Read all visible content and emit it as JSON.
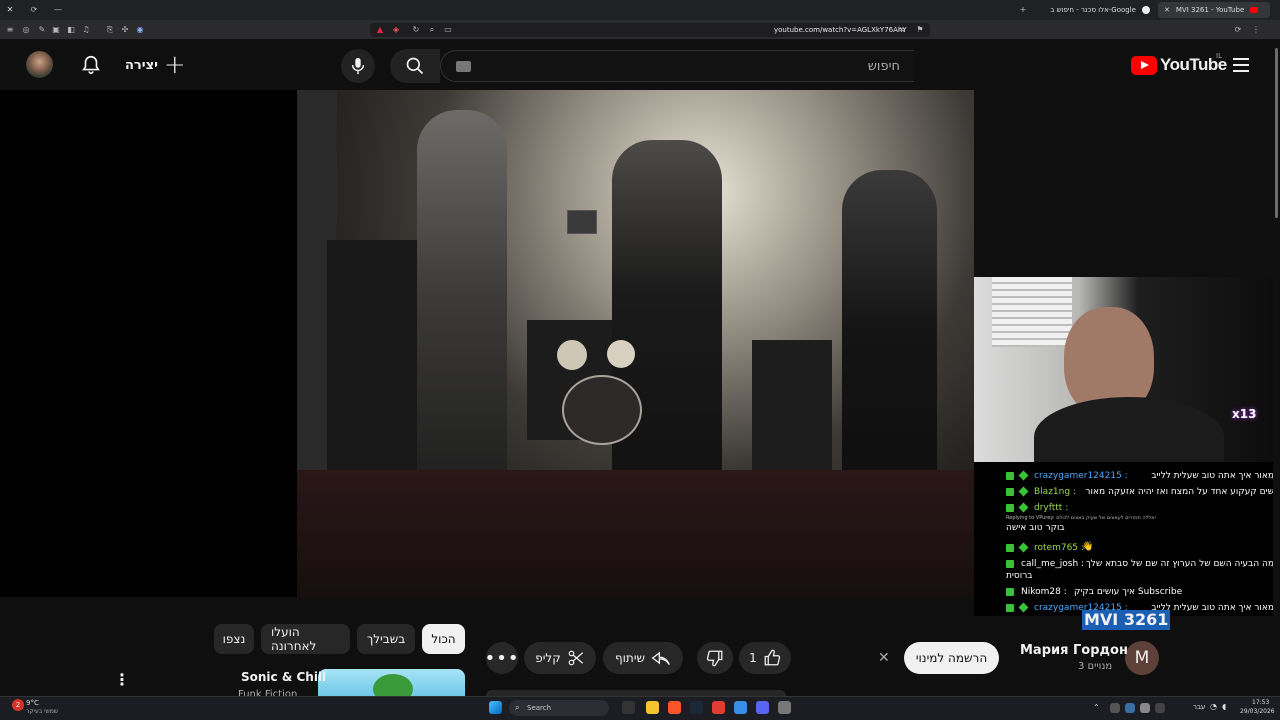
{
  "browser": {
    "tabs": [
      {
        "label": "MVI 3261 - YouTube",
        "active": true
      },
      {
        "label": "אלו סכנר - חיפוש ב-Google",
        "active": false
      }
    ],
    "url": "youtube.com/watch?v=AGLXkY76AhY"
  },
  "header": {
    "logo_text": "YouTube",
    "region": "IL",
    "search_placeholder": "חיפוש",
    "create_label": "יצירה"
  },
  "chat": {
    "messages": [
      {
        "user": "crazygamer124215 :",
        "text": "מאור איך אתה טוב שעלית ללייב"
      },
      {
        "user": "Blaz1ng :",
        "text": "שים קעקוע אחד על המצח ואז יהיה אזעקה מאור"
      },
      {
        "user": "dryfttt :",
        "reply": "Replying to VPurey: יאללה תחזרים לעאצים של שעיק באצים לכולם",
        "text": "בוקר טוב אישה"
      },
      {
        "user": "rotem765 :",
        "text": "👋"
      },
      {
        "user": "call_me_josh :",
        "text": "מה הבעיה השם של הערוץ זה שם של סבתא שלך",
        "text2": "ברוסית"
      },
      {
        "user": "Nikom28 :",
        "text": "איך עושים בקיק Subscribe"
      },
      {
        "user": "crazygamer124215 :",
        "text": "מאור איך אתה טוב שעלית ללייב"
      }
    ],
    "cam_counter": "x13"
  },
  "video": {
    "title": "MVI 3261",
    "channel": "Мария Гордон",
    "channel_initial": "M",
    "subscribers": "3 מנויים",
    "subscribe_label": "הרשמה למינוי",
    "like_count": "1",
    "share_label": "שיתוף",
    "clip_label": "קליפ"
  },
  "filter_chips": [
    "הכול",
    "בשבילך",
    "הועלו לאחרונה",
    "נצפו"
  ],
  "recommendation": {
    "title": "Sonic & Chill",
    "channel": "Funk Fiction"
  },
  "taskbar": {
    "weather_temp": "9°C",
    "weather_text": "שמשי בעיקר",
    "search_label": "Search",
    "lang": "עבר",
    "time": "17:53",
    "date": "29/03/2026",
    "notif_count": "2"
  },
  "colors": {
    "yt_red": "#ff0000",
    "chat_green": "#39c23a",
    "username_blue": "#4aa8ff",
    "username_green": "#9bd94a",
    "title_highlight": "#1a5fb4"
  }
}
